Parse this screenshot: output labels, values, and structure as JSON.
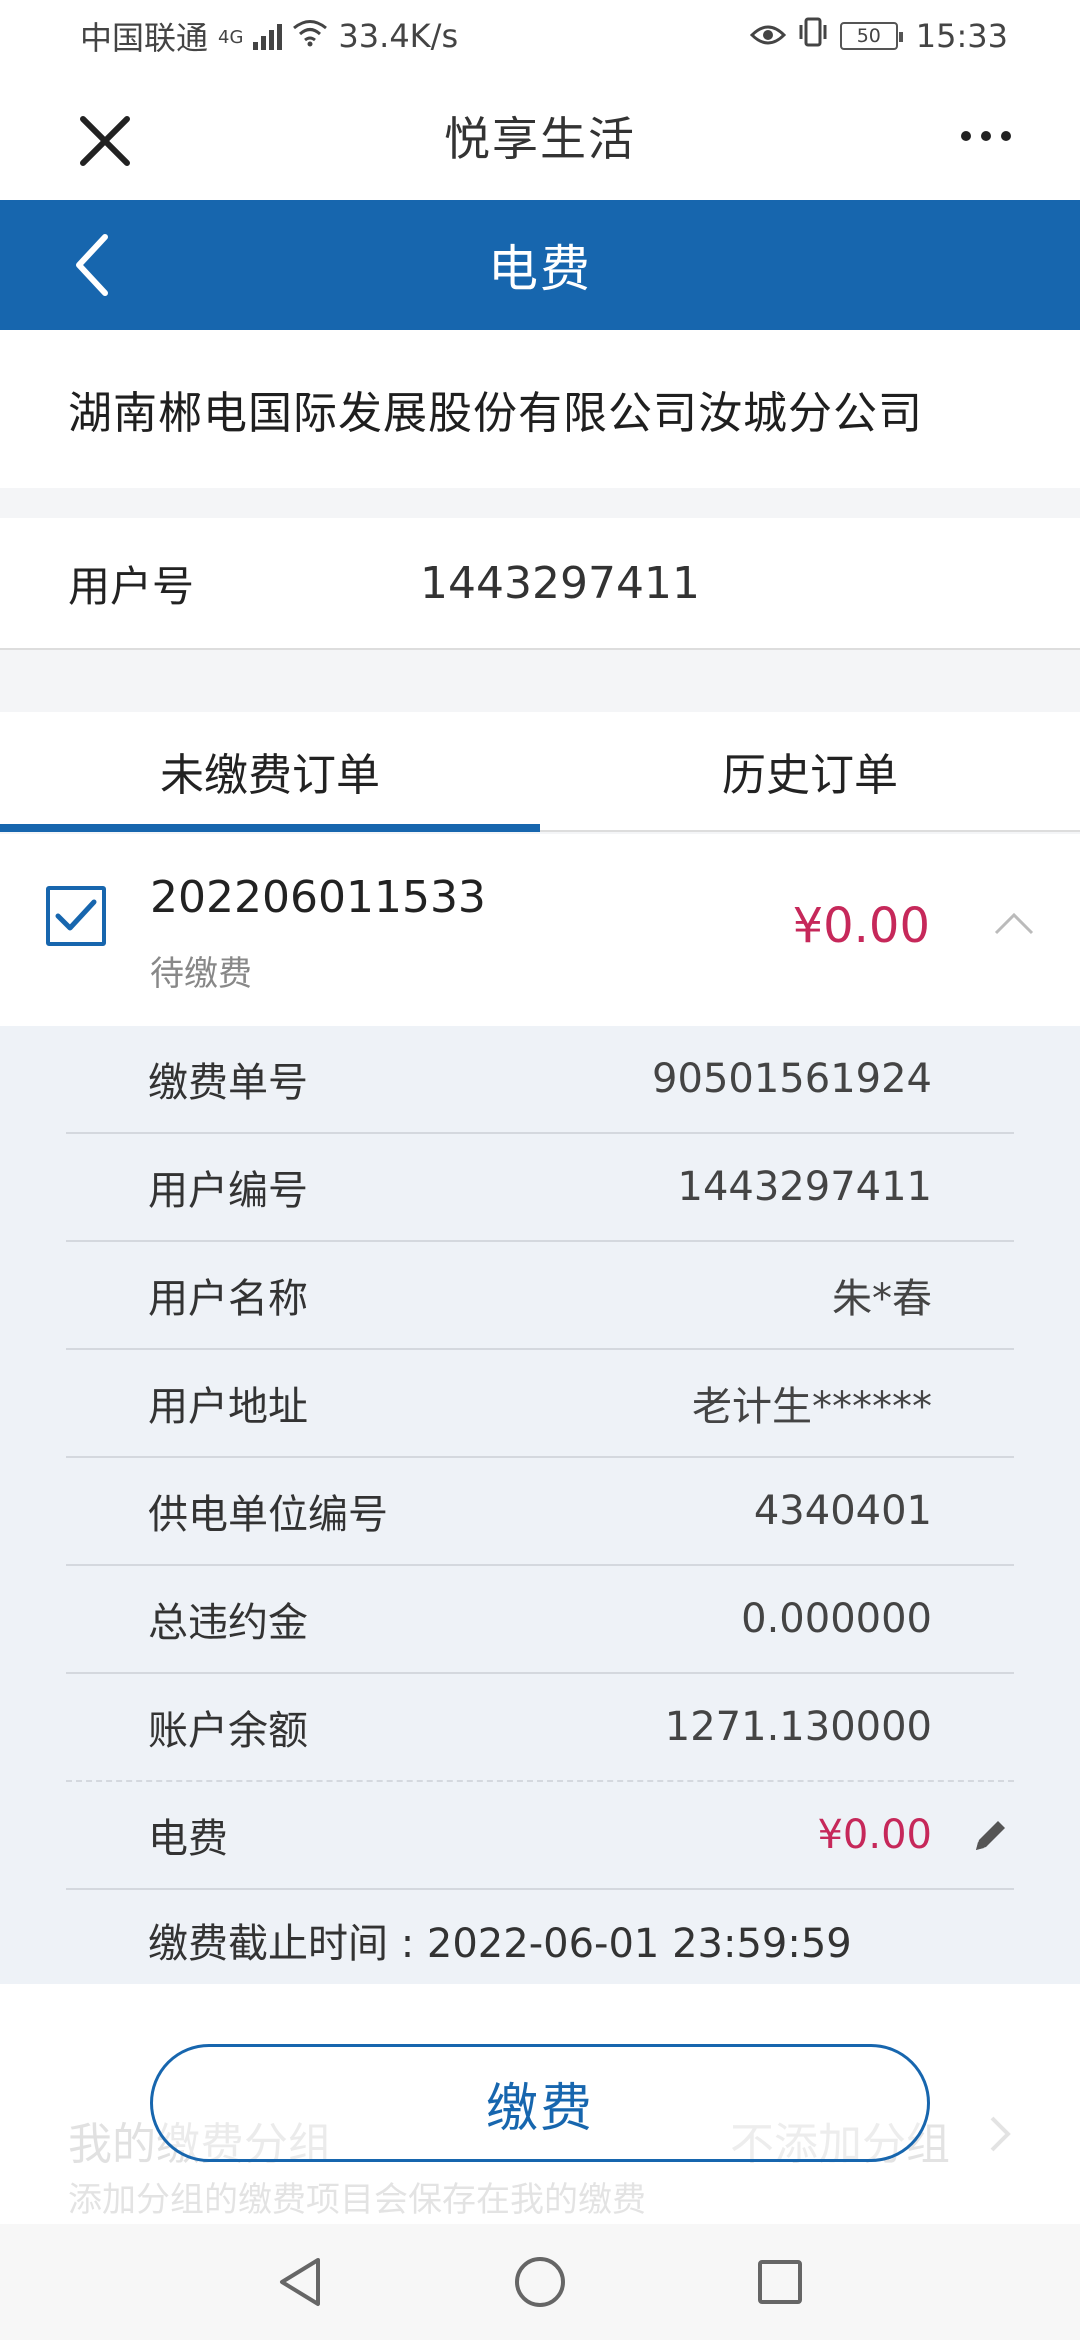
{
  "status_bar": {
    "carrier": "中国联通",
    "network": "4G",
    "speed": "33.4K/s",
    "battery": "50",
    "time": "15:33"
  },
  "header": {
    "title": "悦享生活",
    "close_icon": "close-icon",
    "more_icon": "more-dots-icon"
  },
  "nav": {
    "title": "电费",
    "back_icon": "back-chevron-icon"
  },
  "company": "湖南郴电国际发展股份有限公司汝城分公司",
  "user_number": {
    "label": "用户号",
    "value": "1443297411"
  },
  "tabs": [
    {
      "label": "未缴费订单",
      "active": true
    },
    {
      "label": "历史订单",
      "active": false
    }
  ],
  "order": {
    "checked": true,
    "number": "202206011533",
    "status": "待缴费",
    "amount": "¥0.00"
  },
  "details": [
    {
      "label": "缴费单号",
      "value": "90501561924"
    },
    {
      "label": "用户编号",
      "value": "1443297411"
    },
    {
      "label": "用户名称",
      "value": "朱*春"
    },
    {
      "label": "用户地址",
      "value": "老计生******"
    },
    {
      "label": "供电单位编号",
      "value": "4340401"
    },
    {
      "label": "总违约金",
      "value": "0.000000"
    },
    {
      "label": "账户余额",
      "value": "1271.130000"
    },
    {
      "label": "电费",
      "value": "¥0.00"
    }
  ],
  "deadline": "缴费截止时间 : 2022-06-01 23:59:59",
  "group": {
    "title": "我的缴费分组",
    "subtitle": "添加分组的缴费项目会保存在我的缴费",
    "value": "不添加分组"
  },
  "pay_button": "缴费",
  "colors": {
    "primary": "#1766ae",
    "amount_red": "#c6285a",
    "detail_bg": "#eef2f7"
  }
}
